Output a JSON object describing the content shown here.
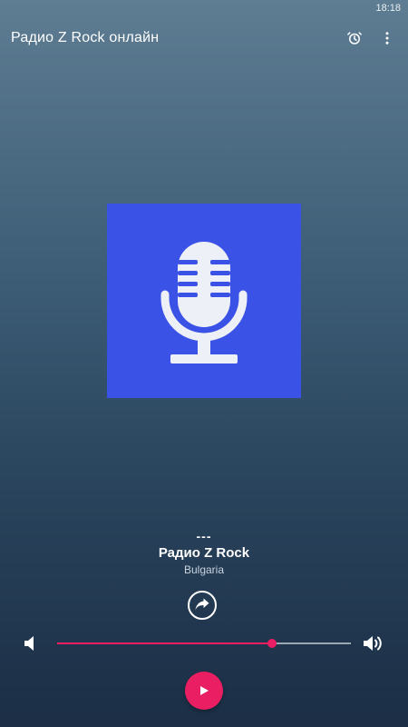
{
  "status_bar": {
    "time": "18:18"
  },
  "app_bar": {
    "title": "Радио Z Rock онлайн",
    "icons": [
      "alarm-icon",
      "more-vert-icon"
    ]
  },
  "cover": {
    "icon": "microphone-icon",
    "background": "#3b52e6"
  },
  "now_playing": {
    "track": "---",
    "station": "Радио Z Rock",
    "country": "Bulgaria"
  },
  "share": {
    "icon": "share-icon"
  },
  "volume": {
    "level": 0.73,
    "min_icon": "volume-mute-icon",
    "max_icon": "volume-up-icon"
  },
  "player": {
    "play_icon": "play-icon"
  },
  "colors": {
    "accent": "#e91e63",
    "cover": "#3b52e6"
  }
}
